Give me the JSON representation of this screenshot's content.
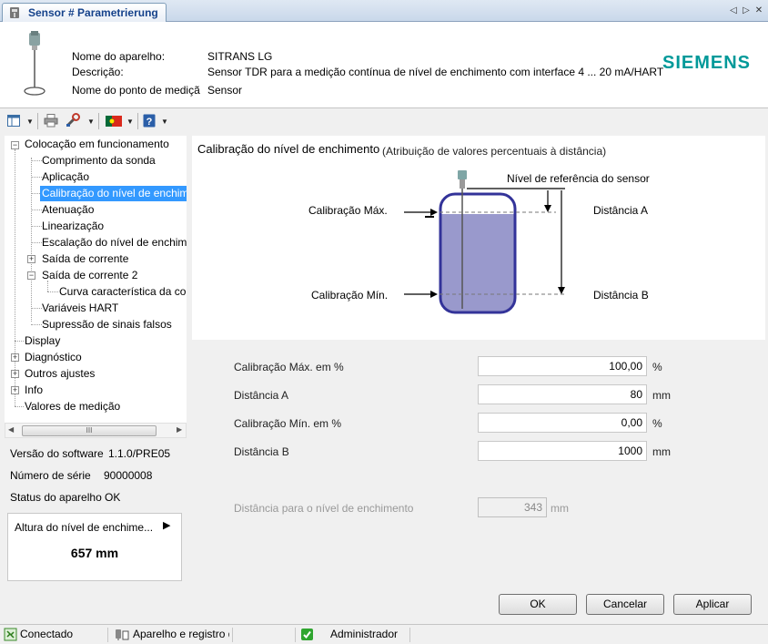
{
  "window": {
    "tab_title": "Sensor # Parametrierung",
    "nav_prev": "◁",
    "nav_next": "▷",
    "nav_close": "✕"
  },
  "header": {
    "device_name_label": "Nome do aparelho:",
    "device_name_value": "SITRANS LG",
    "description_label": "Descrição:",
    "description_value": "Sensor TDR para a medição contínua de nível de enchimento com interface 4 ... 20 mA/HART",
    "measuring_point_label": "Nome do ponto de mediçã",
    "measuring_point_value": "Sensor",
    "brand": "SIEMENS"
  },
  "tree": {
    "items": [
      {
        "label": "Colocação em funcionamento"
      },
      {
        "label": "Comprimento da sonda"
      },
      {
        "label": "Aplicação"
      },
      {
        "label": "Calibração do nível de enchim"
      },
      {
        "label": "Atenuação"
      },
      {
        "label": "Linearização"
      },
      {
        "label": "Escalação do nível de enchime"
      },
      {
        "label": "Saída de corrente"
      },
      {
        "label": "Saída de corrente 2"
      },
      {
        "label": "Curva característica da cor"
      },
      {
        "label": "Variáveis HART"
      },
      {
        "label": "Supressão de sinais falsos"
      },
      {
        "label": "Display"
      },
      {
        "label": "Diagnóstico"
      },
      {
        "label": "Outros ajustes"
      },
      {
        "label": "Info"
      },
      {
        "label": "Valores de medição"
      }
    ],
    "scroll_grip": "III"
  },
  "info": {
    "software_label": "Versão do software",
    "software_value": "1.1.0/PRE05",
    "serial_label": "Número de série",
    "serial_value": "90000008",
    "status_label": "Status do aparelho",
    "status_value": "OK",
    "fill_title": "Altura do nível de enchime...",
    "fill_value": "657 mm"
  },
  "diagram": {
    "title": "Calibração do nível de enchimento",
    "subtitle": "(Atribuição de valores percentuais à distância)",
    "ref_label": "Nível de referência do sensor",
    "max_label": "Calibração Máx.",
    "min_label": "Calibração Mín.",
    "dist_a_label": "Distância A",
    "dist_b_label": "Distância B",
    "fill_color": "#9999cc",
    "tank_color": "#333399"
  },
  "params": {
    "max_cal_label": "Calibração Máx. em %",
    "max_cal_value": "100,00",
    "max_cal_unit": "%",
    "dist_a_label": "Distância A",
    "dist_a_value": "80",
    "dist_a_unit": "mm",
    "min_cal_label": "Calibração Mín. em %",
    "min_cal_value": "0,00",
    "min_cal_unit": "%",
    "dist_b_label": "Distância B",
    "dist_b_value": "1000",
    "dist_b_unit": "mm",
    "fill_dist_label": "Distância para o nível de enchimento",
    "fill_dist_value": "343",
    "fill_dist_unit": "mm"
  },
  "buttons": {
    "ok": "OK",
    "cancel": "Cancelar",
    "apply": "Aplicar"
  },
  "status": {
    "connected": "Conectado",
    "device_registry": "Aparelho e registro d",
    "user": "Administrador"
  }
}
